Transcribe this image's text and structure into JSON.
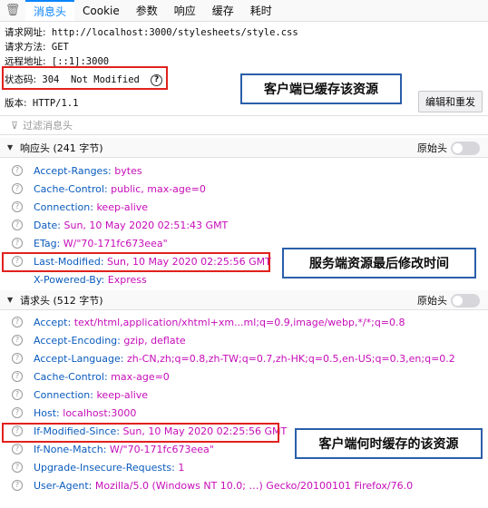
{
  "tabs": {
    "items": [
      "消息头",
      "Cookie",
      "参数",
      "响应",
      "缓存",
      "耗时"
    ]
  },
  "summary": {
    "url_label": "请求网址:",
    "url": "http://localhost:3000/stylesheets/style.css",
    "method_label": "请求方法:",
    "method": "GET",
    "remote_label": "远程地址:",
    "remote": "[::1]:3000",
    "status_label": "状态码:",
    "status": "304  Not Modified",
    "version_label": "版本:",
    "version": "HTTP/1.1"
  },
  "edit_resend_label": "编辑和重发",
  "filter_placeholder": "过滤消息头",
  "response_section": {
    "title": "响应头 (241 字节)",
    "raw_label": "原始头"
  },
  "request_section": {
    "title": "请求头 (512 字节)",
    "raw_label": "原始头"
  },
  "response_headers": [
    {
      "name": "Accept-Ranges:",
      "value": "bytes"
    },
    {
      "name": "Cache-Control:",
      "value": "public, max-age=0"
    },
    {
      "name": "Connection:",
      "value": "keep-alive"
    },
    {
      "name": "Date:",
      "value": "Sun, 10 May 2020 02:51:43 GMT"
    },
    {
      "name": "ETag:",
      "value": "W/\"70-171fc673eea\""
    },
    {
      "name": "Last-Modified:",
      "value": "Sun, 10 May 2020 02:25:56 GMT"
    },
    {
      "name": "X-Powered-By:",
      "value": "Express"
    }
  ],
  "request_headers": [
    {
      "name": "Accept:",
      "value": "text/html,application/xhtml+xm...ml;q=0.9,image/webp,*/*;q=0.8"
    },
    {
      "name": "Accept-Encoding:",
      "value": "gzip, deflate"
    },
    {
      "name": "Accept-Language:",
      "value": "zh-CN,zh;q=0.8,zh-TW;q=0.7,zh-HK;q=0.5,en-US;q=0.3,en;q=0.2"
    },
    {
      "name": "Cache-Control:",
      "value": "max-age=0"
    },
    {
      "name": "Connection:",
      "value": "keep-alive"
    },
    {
      "name": "Host:",
      "value": "localhost:3000"
    },
    {
      "name": "If-Modified-Since:",
      "value": "Sun, 10 May 2020 02:25:56 GMT"
    },
    {
      "name": "If-None-Match:",
      "value": "W/\"70-171fc673eea\""
    },
    {
      "name": "Upgrade-Insecure-Requests:",
      "value": "1"
    },
    {
      "name": "User-Agent:",
      "value": "Mozilla/5.0 (Windows NT 10.0; …) Gecko/20100101 Firefox/76.0"
    }
  ],
  "callouts": {
    "cached": "客户端已缓存该资源",
    "last_modified": "服务端资源最后修改时间",
    "if_modified": "客户端何时缓存的该资源"
  },
  "colors": {
    "accent": "#0a84ff",
    "highlight": "#e0211d",
    "callout_border": "#2a5faa",
    "header_name": "#0a5bbd",
    "header_value": "#c60cb8"
  }
}
